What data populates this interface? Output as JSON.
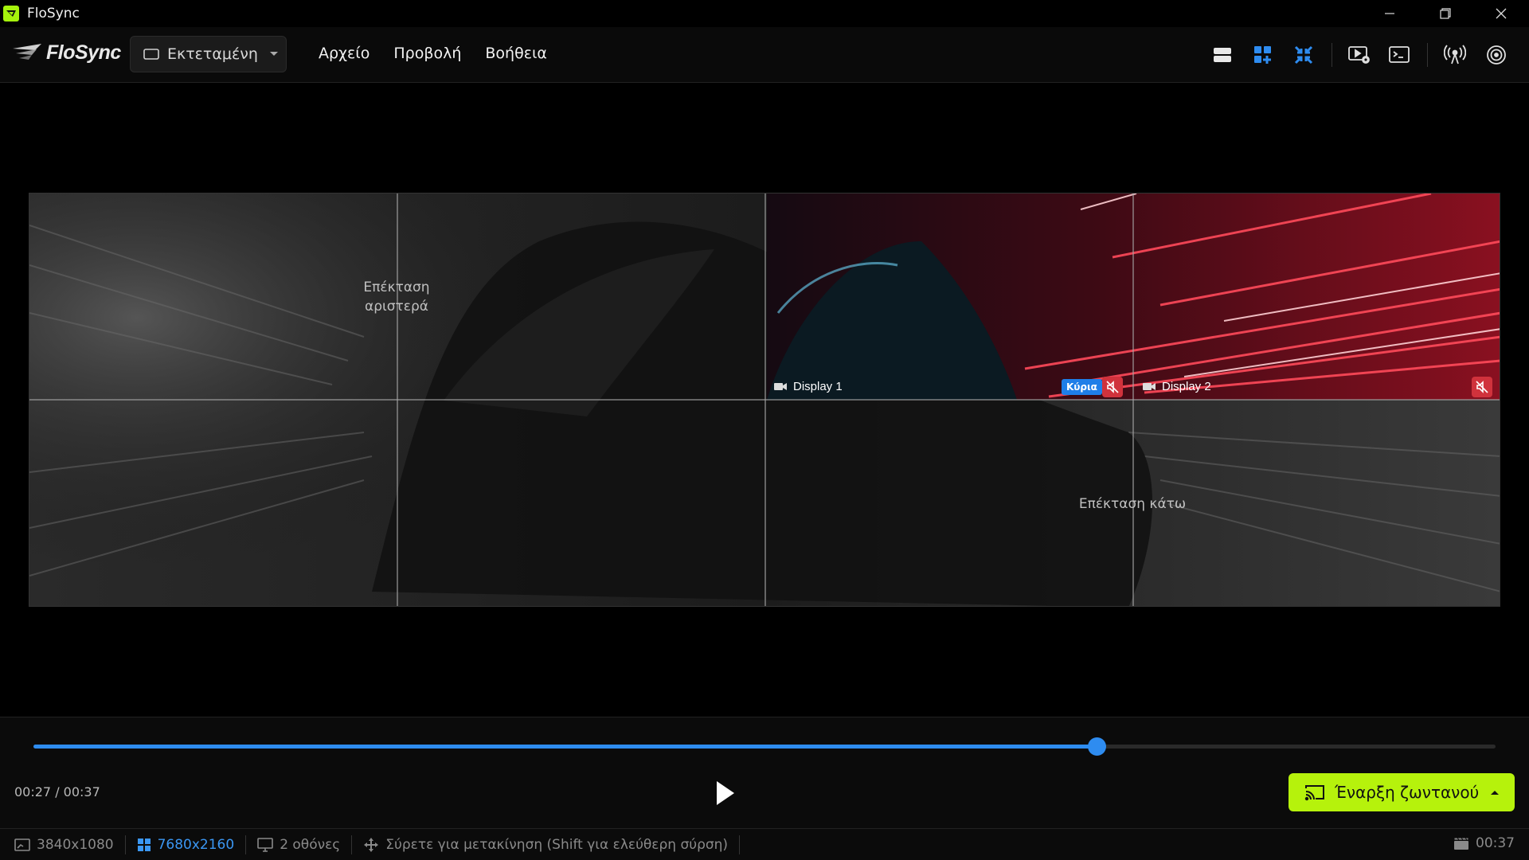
{
  "app": {
    "title": "FloSync",
    "brand": "FloSync"
  },
  "toolbar": {
    "mode_label": "Εκτεταμένη",
    "menu": [
      "Αρχείο",
      "Προβολή",
      "Βοήθεια"
    ],
    "icons": [
      "layout-rows-icon",
      "grid-add-icon",
      "collapse-icon",
      "video-settings-icon",
      "terminal-icon",
      "broadcast-icon",
      "airplay-icon"
    ]
  },
  "canvas": {
    "extend_left": "Επέκταση αριστερά",
    "extend_down": "Επέκταση κάτω",
    "display1": "Display 1",
    "display2": "Display 2",
    "primary_badge": "Κύρια"
  },
  "playback": {
    "time": "00:27 / 00:37",
    "progress": 0.727,
    "live_button": "Έναρξη ζωντανού"
  },
  "status": {
    "display_res": "3840x1080",
    "canvas_res": "7680x2160",
    "screens": "2 οθόνες",
    "hint": "Σύρετε για μετακίνηση (Shift για ελεύθερη σύρση)",
    "duration": "00:37"
  },
  "colors": {
    "accent": "#2e8cf0",
    "live": "#b6f20c",
    "mute": "#d0323c"
  }
}
